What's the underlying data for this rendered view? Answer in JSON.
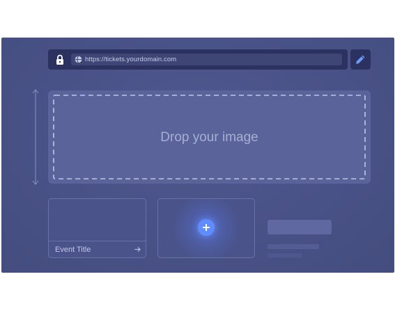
{
  "browser": {
    "url": "https://tickets.yourdomain.com",
    "lock_icon": "lock-icon",
    "globe_icon": "globe-icon",
    "edit_icon": "pencil-icon"
  },
  "dropzone": {
    "label": "Drop your image",
    "resize_icon": "vertical-resize-arrow-icon"
  },
  "cards": {
    "event": {
      "title": "Event Title",
      "arrow_icon": "arrow-right-icon"
    },
    "add": {
      "icon": "plus-icon"
    }
  },
  "colors": {
    "background": "#4a5388",
    "bar": "#2c3260",
    "dropzone": "#5a649a",
    "accent": "#5f8dff",
    "edit_icon": "#6a9cff"
  }
}
